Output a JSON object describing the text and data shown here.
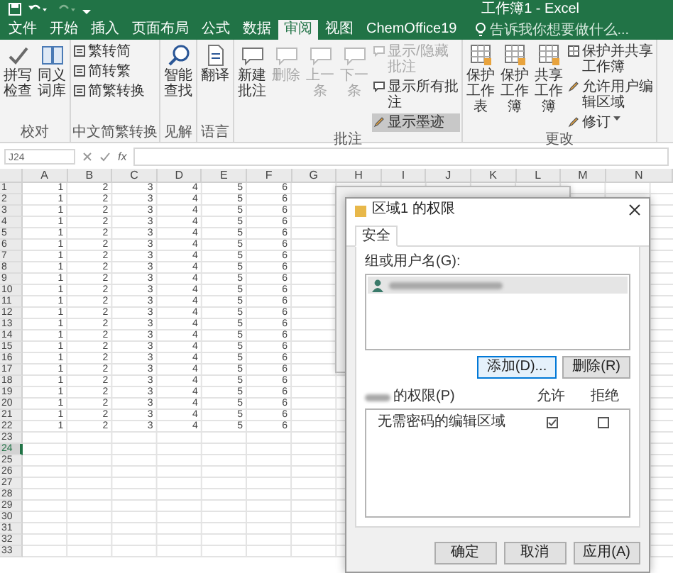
{
  "title_bar": {
    "title": "工作簿1 - Excel"
  },
  "tabs": [
    {
      "label": "文件",
      "selected": false
    },
    {
      "label": "开始",
      "selected": false
    },
    {
      "label": "插入",
      "selected": false
    },
    {
      "label": "页面布局",
      "selected": false
    },
    {
      "label": "公式",
      "selected": false
    },
    {
      "label": "数据",
      "selected": false
    },
    {
      "label": "审阅",
      "selected": true
    },
    {
      "label": "视图",
      "selected": false
    },
    {
      "label": "ChemOffice19",
      "selected": false
    }
  ],
  "search": {
    "placeholder": "告诉我你想要做什么..."
  },
  "ribbon": {
    "groups": [
      {
        "label": "校对",
        "buttons": [
          {
            "kind": "large",
            "label": "拼写检查",
            "disabled": false,
            "selected": false
          },
          {
            "kind": "large",
            "label": "同义词库",
            "disabled": false,
            "selected": false
          }
        ]
      },
      {
        "label": "中文简繁转换",
        "buttons": [
          {
            "kind": "small",
            "label": "繁转简",
            "disabled": false,
            "selected": false
          },
          {
            "kind": "small",
            "label": "简转繁",
            "disabled": false,
            "selected": false
          },
          {
            "kind": "small",
            "label": "简繁转换",
            "disabled": false,
            "selected": false
          }
        ]
      },
      {
        "label": "见解",
        "buttons": [
          {
            "kind": "large",
            "label": "智能查找",
            "disabled": false,
            "selected": false
          }
        ]
      },
      {
        "label": "语言",
        "buttons": [
          {
            "kind": "large",
            "label": "翻译",
            "disabled": false,
            "selected": false
          }
        ]
      },
      {
        "label": "批注",
        "buttons": [
          {
            "kind": "large",
            "label": "新建批注",
            "disabled": false,
            "selected": false
          },
          {
            "kind": "large",
            "label": "删除",
            "disabled": true,
            "selected": false
          },
          {
            "kind": "large",
            "label": "上一条",
            "disabled": true,
            "selected": false
          },
          {
            "kind": "large",
            "label": "下一条",
            "disabled": true,
            "selected": false
          },
          {
            "kind": "small",
            "label": "显示/隐藏批注",
            "disabled": true,
            "selected": false
          },
          {
            "kind": "small",
            "label": "显示所有批注",
            "disabled": false,
            "selected": false
          },
          {
            "kind": "small",
            "label": "显示墨迹",
            "disabled": false,
            "selected": true
          }
        ]
      },
      {
        "label": "更改",
        "buttons": [
          {
            "kind": "large",
            "label": "保护工作表",
            "disabled": false,
            "selected": false
          },
          {
            "kind": "large",
            "label": "保护工作簿",
            "disabled": false,
            "selected": false
          },
          {
            "kind": "large",
            "label": "共享工作簿",
            "disabled": false,
            "selected": false
          },
          {
            "kind": "small",
            "label": "保护并共享工作簿",
            "disabled": false,
            "selected": false
          },
          {
            "kind": "small",
            "label": "允许用户编辑区域",
            "disabled": false,
            "selected": false
          },
          {
            "kind": "small",
            "label": "修订",
            "disabled": false,
            "selected": false,
            "dropdown": true
          }
        ]
      }
    ]
  },
  "formula_bar": {
    "name_box": "J24",
    "function_label": "fx"
  },
  "sheet": {
    "columns": [
      "A",
      "B",
      "C",
      "D",
      "E",
      "F",
      "G",
      "H",
      "I",
      "J",
      "K",
      "L",
      "M",
      "N"
    ],
    "rows": [
      {
        "header": "1",
        "selected": false,
        "cells": [
          "1",
          "2",
          "3",
          "4",
          "5",
          "6"
        ]
      },
      {
        "header": "2",
        "selected": false,
        "cells": [
          "1",
          "2",
          "3",
          "4",
          "5",
          "6"
        ]
      },
      {
        "header": "3",
        "selected": false,
        "cells": [
          "1",
          "2",
          "3",
          "4",
          "5",
          "6"
        ]
      },
      {
        "header": "4",
        "selected": false,
        "cells": [
          "1",
          "2",
          "3",
          "4",
          "5",
          "6"
        ]
      },
      {
        "header": "5",
        "selected": false,
        "cells": [
          "1",
          "2",
          "3",
          "4",
          "5",
          "6"
        ]
      },
      {
        "header": "6",
        "selected": false,
        "cells": [
          "1",
          "2",
          "3",
          "4",
          "5",
          "6"
        ]
      },
      {
        "header": "7",
        "selected": false,
        "cells": [
          "1",
          "2",
          "3",
          "4",
          "5",
          "6"
        ]
      },
      {
        "header": "8",
        "selected": false,
        "cells": [
          "1",
          "2",
          "3",
          "4",
          "5",
          "6"
        ]
      },
      {
        "header": "9",
        "selected": false,
        "cells": [
          "1",
          "2",
          "3",
          "4",
          "5",
          "6"
        ]
      },
      {
        "header": "10",
        "selected": false,
        "cells": [
          "1",
          "2",
          "3",
          "4",
          "5",
          "6"
        ]
      },
      {
        "header": "11",
        "selected": false,
        "cells": [
          "1",
          "2",
          "3",
          "4",
          "5",
          "6"
        ]
      },
      {
        "header": "12",
        "selected": false,
        "cells": [
          "1",
          "2",
          "3",
          "4",
          "5",
          "6"
        ]
      },
      {
        "header": "13",
        "selected": false,
        "cells": [
          "1",
          "2",
          "3",
          "4",
          "5",
          "6"
        ]
      },
      {
        "header": "14",
        "selected": false,
        "cells": [
          "1",
          "2",
          "3",
          "4",
          "5",
          "6"
        ]
      },
      {
        "header": "15",
        "selected": false,
        "cells": [
          "1",
          "2",
          "3",
          "4",
          "5",
          "6"
        ]
      },
      {
        "header": "16",
        "selected": false,
        "cells": [
          "1",
          "2",
          "3",
          "4",
          "5",
          "6"
        ]
      },
      {
        "header": "17",
        "selected": false,
        "cells": [
          "1",
          "2",
          "3",
          "4",
          "5",
          "6"
        ]
      },
      {
        "header": "18",
        "selected": false,
        "cells": [
          "1",
          "2",
          "3",
          "4",
          "5",
          "6"
        ]
      },
      {
        "header": "19",
        "selected": false,
        "cells": [
          "1",
          "2",
          "3",
          "4",
          "5",
          "6"
        ]
      },
      {
        "header": "20",
        "selected": false,
        "cells": [
          "1",
          "2",
          "3",
          "4",
          "5",
          "6"
        ]
      },
      {
        "header": "21",
        "selected": false,
        "cells": [
          "1",
          "2",
          "3",
          "4",
          "5",
          "6"
        ]
      },
      {
        "header": "22",
        "selected": false,
        "cells": [
          "1",
          "2",
          "3",
          "4",
          "5",
          "6"
        ]
      },
      {
        "header": "23",
        "selected": false
      },
      {
        "header": "24",
        "selected": true
      },
      {
        "header": "25",
        "selected": false
      },
      {
        "header": "26",
        "selected": false
      },
      {
        "header": "27",
        "selected": false
      },
      {
        "header": "28",
        "selected": false
      },
      {
        "header": "29",
        "selected": false
      },
      {
        "header": "30",
        "selected": false
      },
      {
        "header": "31",
        "selected": false
      },
      {
        "header": "32",
        "selected": false
      },
      {
        "header": "33",
        "selected": false
      }
    ]
  },
  "dialog": {
    "title": "区域1 的权限",
    "tabs": [
      {
        "label": "安全",
        "selected": true
      }
    ],
    "users_label": "组或用户名(G):",
    "users": [
      {
        "selected": true
      }
    ],
    "add_button": {
      "label": "添加(D)...",
      "focused": true
    },
    "remove_button": {
      "label": "删除(R)",
      "focused": false
    },
    "permissions_label": "的权限(P)",
    "allow_header": "允许",
    "deny_header": "拒绝",
    "permissions": [
      {
        "name": "无需密码的编辑区域",
        "allow": true,
        "deny": false
      }
    ],
    "buttons": [
      "确定",
      "取消",
      "应用(A)"
    ]
  }
}
